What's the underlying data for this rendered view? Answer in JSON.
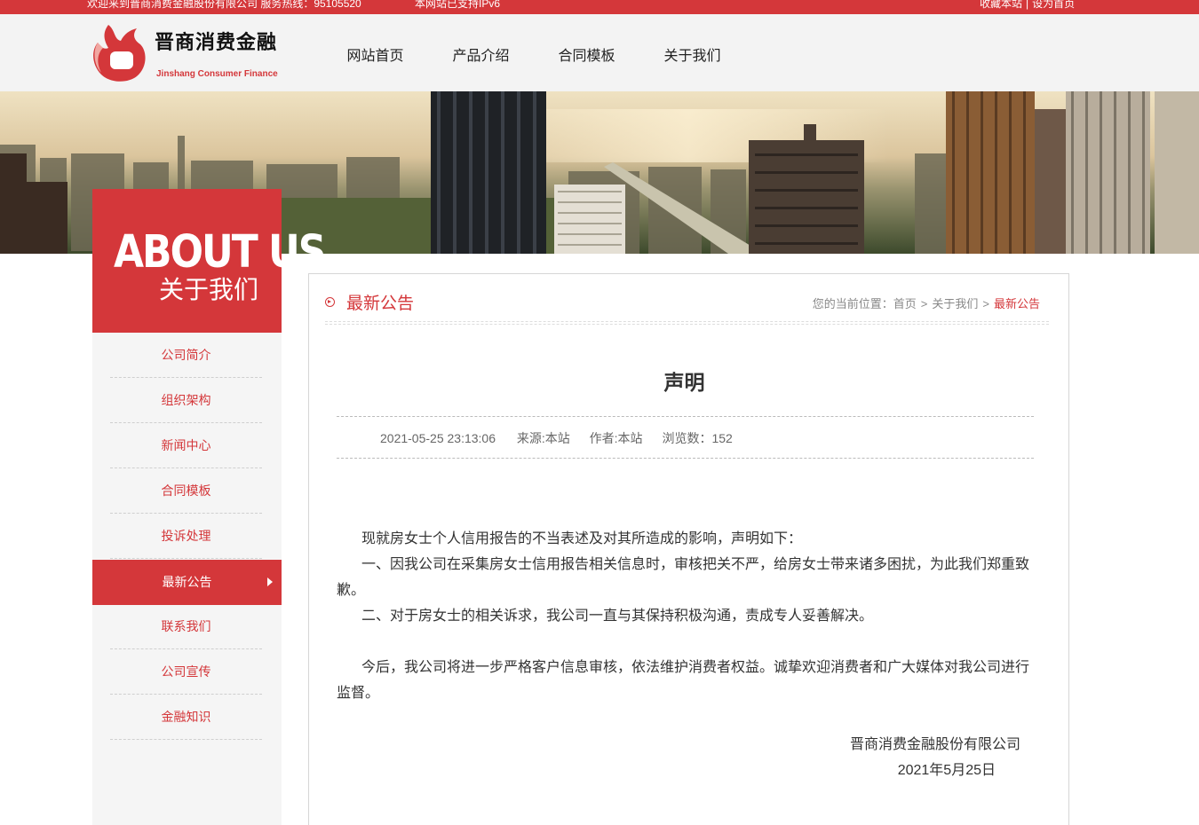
{
  "topbar": {
    "welcome": "欢迎来到晋商消费金融股份有限公司  服务热线：95105520",
    "ipv6": "本网站已支持IPv6",
    "favorite": "收藏本站",
    "separator": "|",
    "homepage": "设为首页"
  },
  "logo": {
    "cn": "晋商消费金融",
    "en": "Jinshang Consumer Finance"
  },
  "nav": [
    "网站首页",
    "产品介绍",
    "合同模板",
    "关于我们"
  ],
  "about": {
    "en": "ABOUT US",
    "cn": "关于我们"
  },
  "sidebar": {
    "items": [
      "公司简介",
      "组织架构",
      "新闻中心",
      "合同模板",
      "投诉处理",
      "最新公告",
      "联系我们",
      "公司宣传",
      "金融知识"
    ],
    "active": "最新公告"
  },
  "panel": {
    "title": "最新公告",
    "breadcrumb": {
      "prefix": "您的当前位置：",
      "home": "首页",
      "section": "关于我们",
      "current": "最新公告",
      "sep": ">"
    }
  },
  "article": {
    "title": "声明",
    "date": "2021-05-25 23:13:06",
    "source": "来源:本站",
    "author": "作者:本站",
    "views": "浏览数：152",
    "paragraphs": [
      "现就房女士个人信用报告的不当表述及对其所造成的影响，声明如下：",
      "一、因我公司在采集房女士信用报告相关信息时，审核把关不严，给房女士带来诸多困扰，为此我们郑重致歉。",
      "二、对于房女士的相关诉求，我公司一直与其保持积极沟通，责成专人妥善解决。",
      "今后，我公司将进一步严格客户信息审核，依法维护消费者权益。诚挚欢迎消费者和广大媒体对我公司进行监督。"
    ],
    "signature": "晋商消费金融股份有限公司",
    "sign_date": "2021年5月25日"
  },
  "colors": {
    "brand": "#d4373a"
  }
}
